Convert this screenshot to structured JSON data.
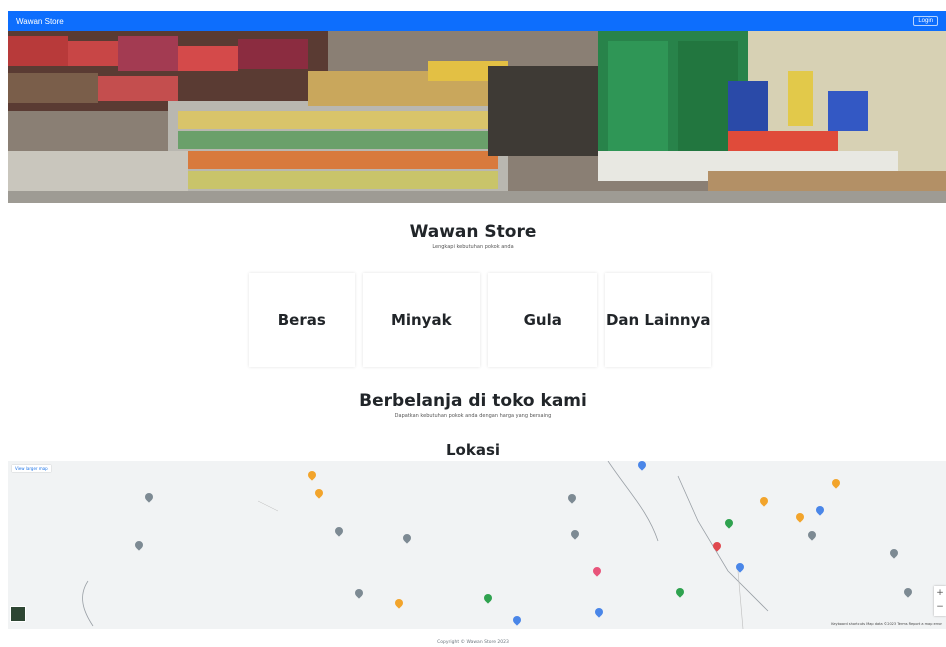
{
  "navbar": {
    "brand": "Wawan Store",
    "button_label": "Login"
  },
  "hero": {
    "image_alt": "store-front-photo"
  },
  "intro": {
    "title": "Wawan Store",
    "subtitle": "Lengkapi kebutuhan pokok anda"
  },
  "categories": [
    {
      "label": "Beras"
    },
    {
      "label": "Minyak"
    },
    {
      "label": "Gula"
    },
    {
      "label": "Dan Lainnya"
    }
  ],
  "shop": {
    "title": "Berbelanja di toko kami",
    "subtitle": "Dapatkan kebutuhan pokok anda dengan harga yang bersaing"
  },
  "location": {
    "title": "Lokasi",
    "view_larger": "View larger map",
    "footer": "Keyboard shortcuts   Map data ©2023   Terms   Report a map error",
    "zoom_in": "+",
    "zoom_out": "−"
  },
  "footer": {
    "copyright": "Copyright © Wawan Store 2023"
  },
  "colors": {
    "navbar": "#0d6efd"
  }
}
